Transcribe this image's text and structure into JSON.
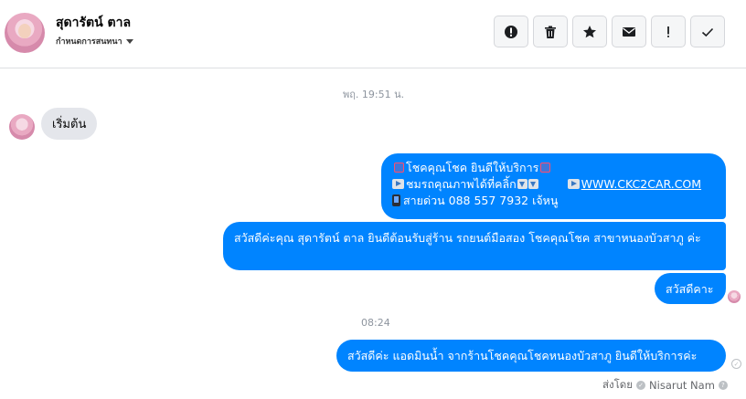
{
  "header": {
    "contact_name": "สุดารัตน์ ตาล",
    "contact_subtitle": "กำหนดการสนทนา",
    "tools": [
      "alert-circle-icon",
      "trash-icon",
      "star-icon",
      "envelope-icon",
      "exclamation-icon",
      "check-icon"
    ]
  },
  "conversation": {
    "timestamp_1": "พฤ. 19:51 น.",
    "timestamp_2": "08:24",
    "incoming": {
      "text": "เริ่มต้น"
    },
    "outgoing_1": {
      "line1_text": "โชคคุณโชค ยินดีให้บริการ",
      "line2_text": "ชมรถคุณภาพได้ที่คลิ้ก",
      "line2_link": "WWW.CKC2CAR.COM",
      "line3_text": "สายด่วน 088 557 7932 เจ้หนู"
    },
    "outgoing_2": {
      "text": "สวัสดีค่ะคุณ สุดารัตน์ ตาล ยินดีต้อนรับสู่ร้าน รถยนต์มือสอง โชคคุณโชค สาขาหนองบัวสาภู ค่ะ"
    },
    "outgoing_3": {
      "text": "สวัสดีคาะ"
    },
    "outgoing_4": {
      "text": "สวัสดีค่ะ แอดมินน้ำ จากร้านโชคคุณโชคหนองบัวสาภู ยินดีให้บริการค่ะ"
    },
    "sent_by": {
      "label": "ส่งโดย",
      "name": "Nisarut Nam"
    }
  },
  "colors": {
    "outgoing_bubble": "#0084ff",
    "incoming_bubble": "#e4e6eb"
  }
}
